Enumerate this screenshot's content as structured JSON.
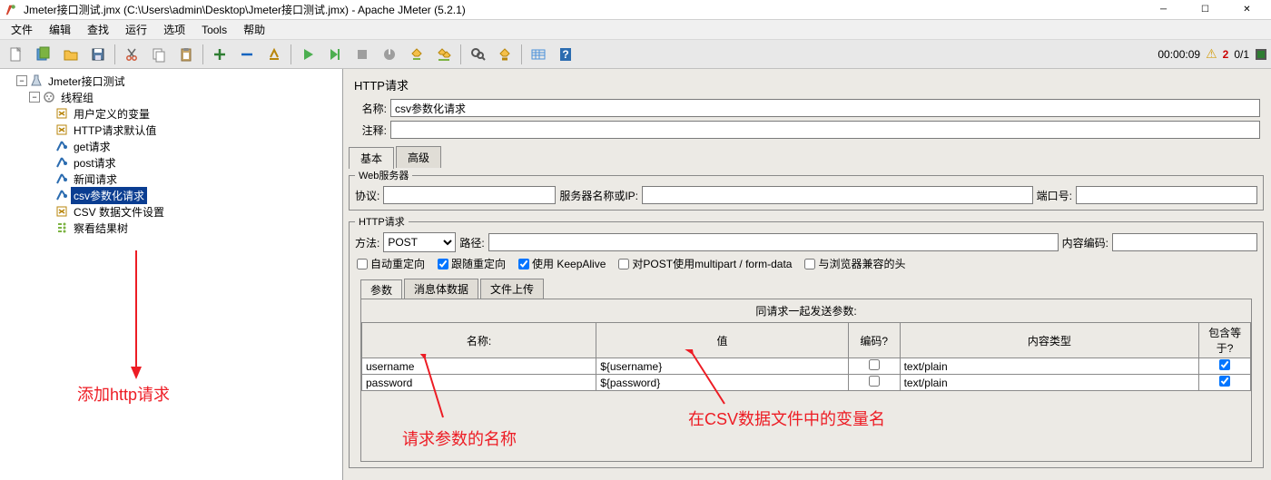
{
  "window": {
    "title": "Jmeter接口测试.jmx (C:\\Users\\admin\\Desktop\\Jmeter接口测试.jmx) - Apache JMeter (5.2.1)"
  },
  "menu": {
    "file": "文件",
    "edit": "编辑",
    "find": "查找",
    "run": "运行",
    "options": "选项",
    "tools": "Tools",
    "help": "帮助"
  },
  "status": {
    "time": "00:00:09",
    "warn_count": "2",
    "active": "0/1"
  },
  "tree": {
    "root": "Jmeter接口测试",
    "thread": "线程组",
    "items": [
      "用户定义的变量",
      "HTTP请求默认值",
      "get请求",
      "post请求",
      "新闻请求",
      "csv参数化请求",
      "CSV 数据文件设置",
      "察看结果树"
    ],
    "selected_index": 5
  },
  "panel": {
    "title": "HTTP请求",
    "name_label": "名称:",
    "name_value": "csv参数化请求",
    "comment_label": "注释:",
    "comment_value": "",
    "tabs": {
      "basic": "基本",
      "advanced": "高级"
    },
    "webserver": {
      "legend": "Web服务器",
      "protocol": "协议:",
      "server": "服务器名称或IP:",
      "port": "端口号:"
    },
    "httpreq": {
      "legend": "HTTP请求",
      "method": "方法:",
      "method_value": "POST",
      "path": "路径:",
      "encoding": "内容编码:"
    },
    "checks": {
      "auto": "自动重定向",
      "follow": "跟随重定向",
      "keepalive": "使用 KeepAlive",
      "multipart": "对POST使用multipart / form-data",
      "browser": "与浏览器兼容的头"
    },
    "ptabs": {
      "params": "参数",
      "body": "消息体数据",
      "upload": "文件上传"
    },
    "param_header": "同请求一起发送参数:",
    "cols": {
      "name": "名称:",
      "value": "值",
      "encode": "编码?",
      "ctype": "内容类型",
      "eq": "包含等于?"
    },
    "rows": [
      {
        "name": "username",
        "value": "${username}",
        "encode": false,
        "ctype": "text/plain",
        "eq": true
      },
      {
        "name": "password",
        "value": "${password}",
        "encode": false,
        "ctype": "text/plain",
        "eq": true
      }
    ]
  },
  "annotations": {
    "tree": "添加http请求",
    "pname": "请求参数的名称",
    "pval": "在CSV数据文件中的变量名"
  }
}
